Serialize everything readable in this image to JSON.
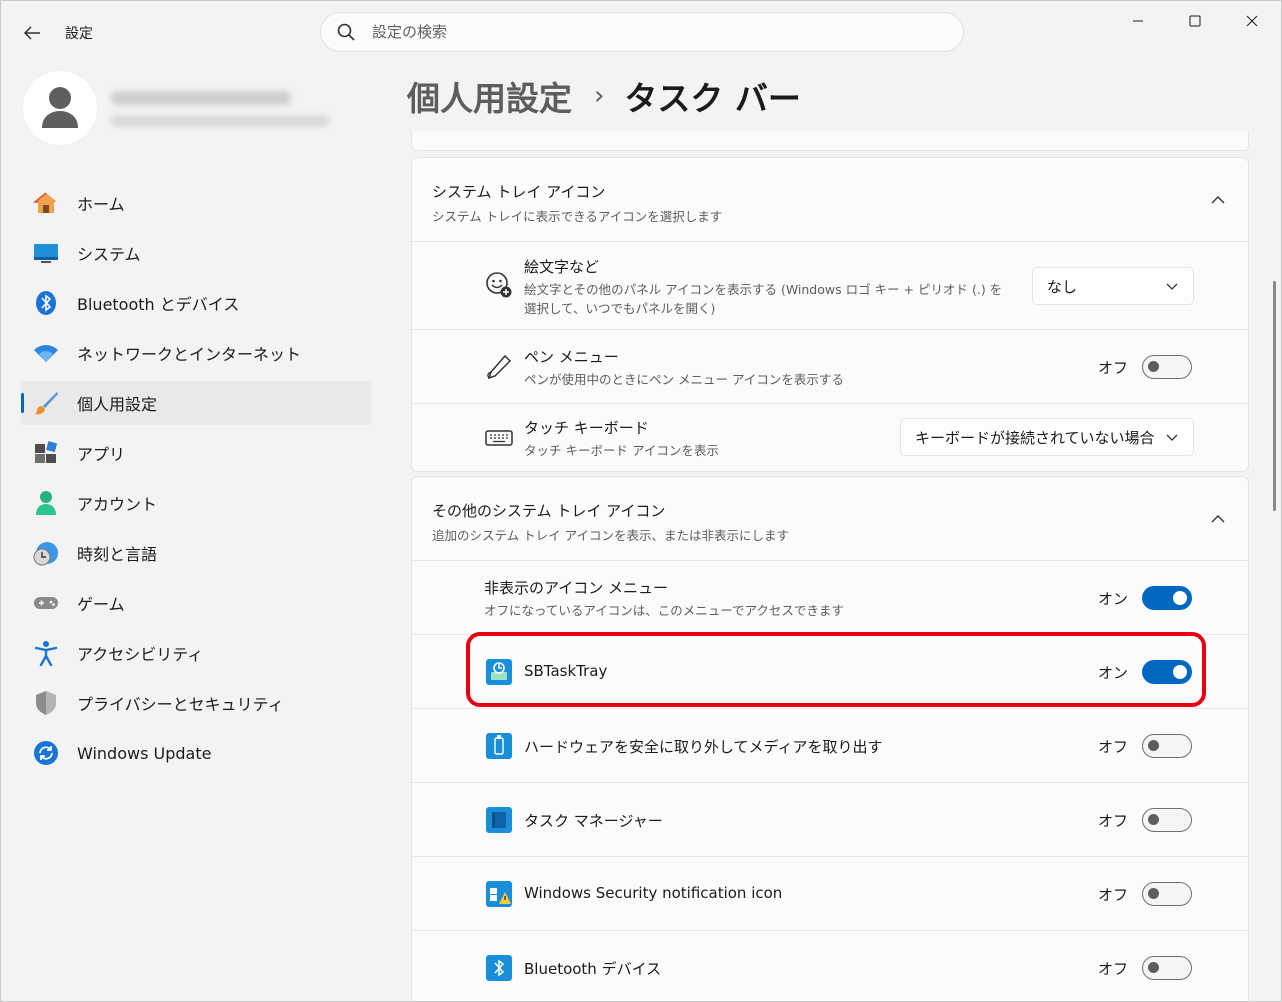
{
  "titlebar": {
    "app_title": "設定",
    "search_placeholder": "設定の検索"
  },
  "sidebar": {
    "items": [
      {
        "label": "ホーム",
        "icon": "home-icon"
      },
      {
        "label": "システム",
        "icon": "system-icon"
      },
      {
        "label": "Bluetooth とデバイス",
        "icon": "bluetooth-icon"
      },
      {
        "label": "ネットワークとインターネット",
        "icon": "wifi-icon"
      },
      {
        "label": "個人用設定",
        "icon": "brush-icon",
        "active": true
      },
      {
        "label": "アプリ",
        "icon": "apps-icon"
      },
      {
        "label": "アカウント",
        "icon": "account-icon"
      },
      {
        "label": "時刻と言語",
        "icon": "time-language-icon"
      },
      {
        "label": "ゲーム",
        "icon": "gamepad-icon"
      },
      {
        "label": "アクセシビリティ",
        "icon": "accessibility-icon"
      },
      {
        "label": "プライバシーとセキュリティ",
        "icon": "shield-icon"
      },
      {
        "label": "Windows Update",
        "icon": "update-icon"
      }
    ]
  },
  "header": {
    "parent": "個人用設定",
    "separator": "›",
    "current": "タスク バー"
  },
  "system_tray": {
    "title": "システム トレイ アイコン",
    "subtitle": "システム トレイに表示できるアイコンを選択します",
    "rows": {
      "emoji": {
        "title": "絵文字など",
        "subtitle_line1": "絵文字とその他のパネル アイコンを表示する (Windows ロゴ キー + ピリオド (.) を",
        "subtitle_line2": "選択して、いつでもパネルを開く)",
        "dropdown_value": "なし"
      },
      "pen": {
        "title": "ペン メニュー",
        "subtitle": "ペンが使用中のときにペン メニュー アイコンを表示する",
        "state_label": "オフ",
        "on": false
      },
      "touch_keyboard": {
        "title": "タッチ キーボード",
        "subtitle": "タッチ キーボード アイコンを表示",
        "dropdown_value": "キーボードが接続されていない場合"
      }
    }
  },
  "other_tray": {
    "title": "その他のシステム トレイ アイコン",
    "subtitle": "追加のシステム トレイ アイコンを表示、または非表示にします",
    "rows": {
      "hidden_menu": {
        "title": "非表示のアイコン メニュー",
        "subtitle": "オフになっているアイコンは、このメニューでアクセスできます",
        "state_label": "オン",
        "on": true
      },
      "sbtasktray": {
        "title": "SBTaskTray",
        "state_label": "オン",
        "on": true
      },
      "safely_remove": {
        "title": "ハードウェアを安全に取り外してメディアを取り出す",
        "state_label": "オフ",
        "on": false
      },
      "task_manager": {
        "title": "タスク マネージャー",
        "state_label": "オフ",
        "on": false
      },
      "windows_security": {
        "title": "Windows Security notification icon",
        "state_label": "オフ",
        "on": false
      },
      "bluetooth_devices": {
        "title": "Bluetooth デバイス",
        "state_label": "オフ",
        "on": false
      }
    }
  },
  "colors": {
    "accent": "#0067c0",
    "highlight": "#e60012",
    "background": "#f3f3f3",
    "card": "#fbfbfb"
  }
}
